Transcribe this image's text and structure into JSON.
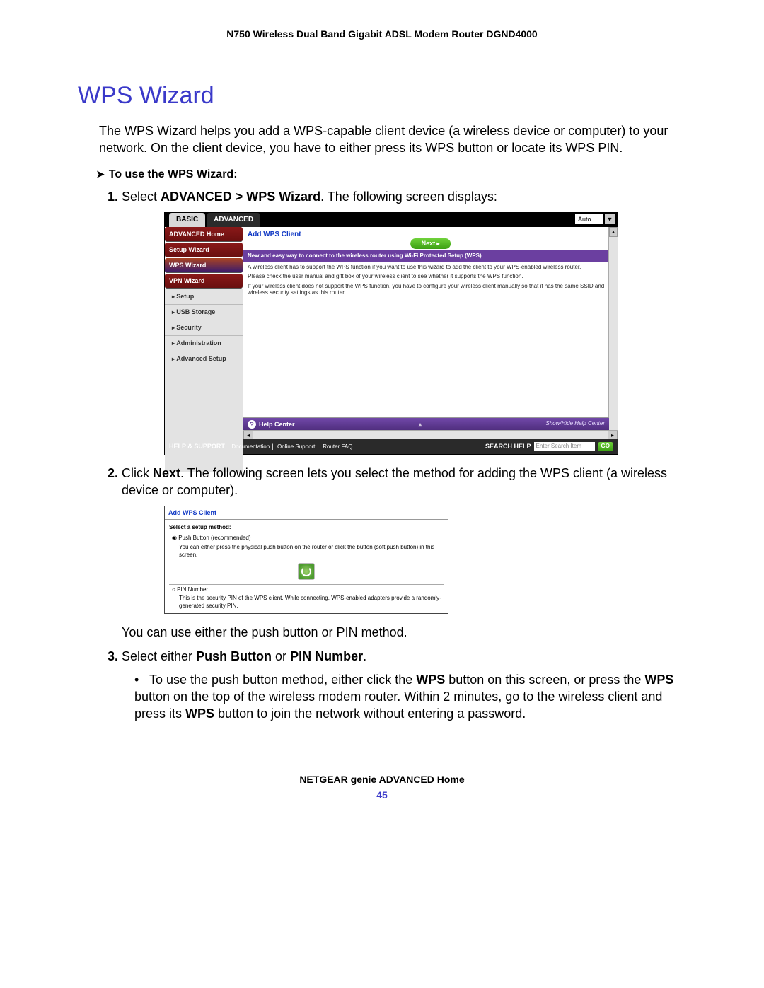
{
  "header": {
    "title": "N750 Wireless Dual Band Gigabit ADSL Modem Router DGND4000"
  },
  "section": {
    "title": "WPS Wizard"
  },
  "intro": "The WPS Wizard helps you add a WPS-capable client device (a wireless device or computer) to your network. On the client device, you have to either press its WPS button or locate its WPS PIN.",
  "proc_head": "To use the WPS Wizard:",
  "step1": {
    "pre": "Select ",
    "bold": "ADVANCED > WPS Wizard",
    "post": ". The following screen displays:"
  },
  "shot1": {
    "tabs": {
      "basic": "BASIC",
      "advanced": "ADVANCED",
      "auto": "Auto"
    },
    "menu": {
      "home": "ADVANCED Home",
      "setupwiz": "Setup Wizard",
      "wpswiz": "WPS Wizard",
      "vpnwiz": "VPN Wizard",
      "setup": "Setup",
      "usb": "USB Storage",
      "security": "Security",
      "admin": "Administration",
      "advsetup": "Advanced Setup"
    },
    "content": {
      "title": "Add WPS Client",
      "next": "Next",
      "subhead": "New and easy way to connect to the wireless router using Wi-Fi Protected Setup (WPS)",
      "p1": "A wireless client has to support the WPS function if you want to use this wizard to add the client to your WPS-enabled wireless router.",
      "p2": "Please check the user manual and gift box of your wireless client to see whether it supports the WPS function.",
      "p3": "If your wireless client does not support the WPS function, you have to configure your wireless client manually so that it has the same SSID and wireless security settings as this router."
    },
    "helpcenter": {
      "label": "Help Center",
      "link": "Show/Hide Help Center"
    },
    "footer": {
      "label": "HELP & SUPPORT",
      "doc": "Documentation",
      "online": "Online Support",
      "faq": "Router FAQ",
      "search_label": "SEARCH HELP",
      "search_placeholder": "Enter Search Item",
      "go": "GO"
    }
  },
  "step2": {
    "pre": "Click ",
    "bold": "Next",
    "post": ". The following screen lets you select the method for adding the WPS client (a wireless device or computer)."
  },
  "shot2": {
    "title": "Add WPS Client",
    "subhead": "Select a setup method:",
    "opt1": {
      "label": "Push Button (recommended)",
      "desc": "You can either press the physical push button on the router or click the button (soft push button) in this screen."
    },
    "opt2": {
      "label": "PIN Number",
      "desc": "This is the security PIN of the WPS client. While connecting, WPS-enabled adapters provide a randomly-generated security PIN."
    }
  },
  "after2": "You can use either the push button or PIN method.",
  "step3": {
    "pre": "Select either ",
    "b1": "Push Button",
    "mid": " or ",
    "b2": "PIN Number",
    "post": "."
  },
  "bullet": {
    "t1": "To use the push button method, either click the ",
    "b1": "WPS",
    "t2": " button on this screen, or press the ",
    "b2": "WPS",
    "t3": " button on the top of the wireless modem router. Within 2 minutes, go to the wireless client and press its ",
    "b3": "WPS",
    "t4": " button to join the network without entering a password."
  },
  "footer": {
    "label": "NETGEAR genie ADVANCED Home",
    "page": "45"
  }
}
